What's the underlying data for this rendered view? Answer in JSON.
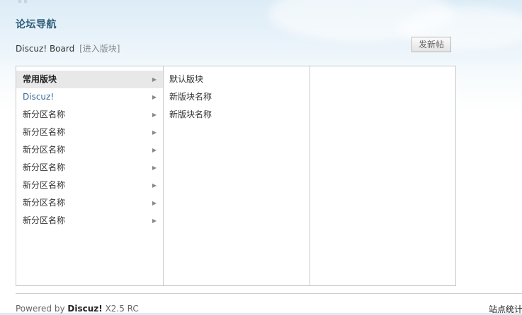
{
  "header": {
    "page_title": "论坛导航",
    "board_name": "Discuz! Board",
    "enter_link": "[进入版块]",
    "post_button": "发新帖"
  },
  "categories": [
    {
      "label": "常用版块",
      "active": true
    },
    {
      "label": "Discuz!",
      "link": true
    },
    {
      "label": "新分区名称"
    },
    {
      "label": "新分区名称"
    },
    {
      "label": "新分区名称"
    },
    {
      "label": "新分区名称"
    },
    {
      "label": "新分区名称"
    },
    {
      "label": "新分区名称"
    },
    {
      "label": "新分区名称"
    }
  ],
  "forums": [
    {
      "label": "默认版块"
    },
    {
      "label": "新版块名称"
    },
    {
      "label": "新版块名称"
    }
  ],
  "footer": {
    "powered_prefix": "Powered by",
    "powered_brand": "Discuz!",
    "powered_version": "X2.5 RC",
    "stats_link": "站点统计"
  },
  "colors": {
    "title": "#2c5a78",
    "link": "#336699",
    "active_row": "#e8e8e8",
    "border": "#c9c9c9"
  },
  "icons": {
    "category_arrow": "triangle-right-icon"
  }
}
